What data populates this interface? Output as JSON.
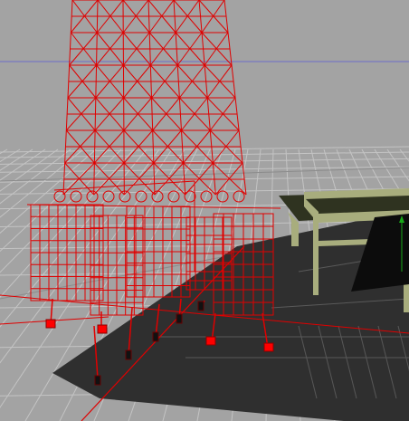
{
  "viewport": {
    "view": "perspective",
    "background_color": "#a3a3a3",
    "grid_color": "#c4c4c4",
    "grid_dark_color": "#8c8c8c",
    "horizon_line_color": "#6e6ec8",
    "selection_color": "#e00000",
    "shadow_color": "#2f2f2f",
    "furniture_color": "#a8ad7d",
    "furniture_top_color": "#2f3320",
    "panel_color": "#0c0c0c",
    "axis_color": "#18a818"
  },
  "scene": {
    "objects": [
      {
        "name": "lattice-tower",
        "selected": true,
        "render": "wireframe"
      },
      {
        "name": "table",
        "selected": false,
        "render": "shaded"
      },
      {
        "name": "dark-panel",
        "selected": false,
        "render": "shaded"
      }
    ]
  }
}
